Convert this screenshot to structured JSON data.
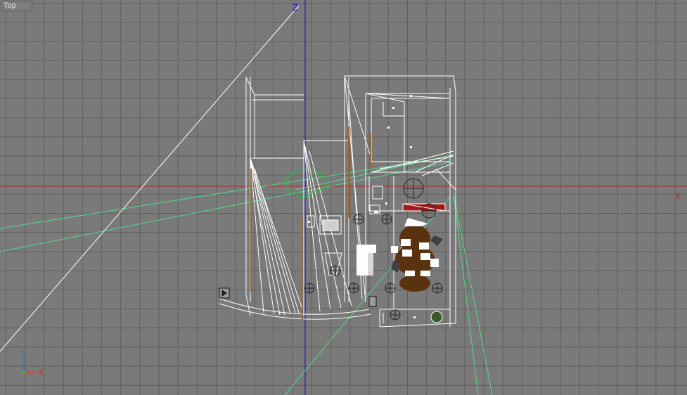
{
  "viewport": {
    "label": "Top",
    "axis_labels": {
      "vertical": "Z",
      "horizontal": "X"
    },
    "gizmo": {
      "up": "Z",
      "right": "X"
    }
  },
  "colors": {
    "background": "#7a7a7a",
    "grid": "#5e5e5e",
    "x_axis": "#b22a2a",
    "z_axis": "#1c1cb0",
    "wireframe": "#ffffff",
    "camera_frustum": "#55d88a",
    "furniture_wood": "#5a3210",
    "gizmo_x": "#e03030",
    "gizmo_z": "#3a6ae0",
    "gizmo_origin": "#30d040"
  }
}
